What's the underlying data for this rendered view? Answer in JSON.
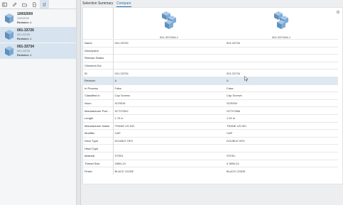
{
  "toolbar": {
    "icons": [
      "panel-icon",
      "edit-icon",
      "folder-icon",
      "document-icon",
      "compare-icon"
    ]
  },
  "left_items": [
    {
      "title": "10002000",
      "subtitle": "10002000",
      "revision_label": "Revision:",
      "revision": "A",
      "selected": false
    },
    {
      "title": "001-33726",
      "subtitle": "001-33726",
      "revision_label": "Revision:",
      "revision": "A",
      "selected": true
    },
    {
      "title": "001-33734",
      "subtitle": "001-33734",
      "revision_label": "Revision:",
      "revision": "A",
      "selected": true
    }
  ],
  "tabs": {
    "summary": "Selection Summary",
    "compare": "Compare"
  },
  "parts": {
    "part1": "001-33726/A.1",
    "part2": "001-33734/A.1"
  },
  "rows": [
    {
      "label": "Name",
      "v1": "001-33726",
      "v2": "001-33734"
    },
    {
      "label": "Description",
      "v1": "",
      "v2": ""
    },
    {
      "label": "Release Status",
      "v1": "",
      "v2": ""
    },
    {
      "label": "Checked-Out",
      "v1": "",
      "v2": ""
    },
    {
      "label": "ID",
      "v1": "001-33726",
      "v2": "001-33734"
    },
    {
      "label": "Revision",
      "v1": "A",
      "v2": "A"
    },
    {
      "label": "In Process",
      "v1": "False",
      "v2": "False"
    },
    {
      "label": "Classified in",
      "v1": "Cap Screws",
      "v2": "Cap Screws"
    },
    {
      "label": "Noun",
      "v1": "SCREW",
      "v2": "SCREW"
    },
    {
      "label": "Manufacturer Part ...",
      "v1": "SCT07842",
      "v2": "SCT07856"
    },
    {
      "label": "Length",
      "v1": "1.75 in",
      "v2": "1.00 in"
    },
    {
      "label": "Manufacturer Name",
      "v1": "TRANE US INC",
      "v2": "TRANE US INC"
    },
    {
      "label": "Modifier",
      "v1": "CAP",
      "v2": "CAP"
    },
    {
      "label": "Drive Type",
      "v1": "DOUBLE HEX",
      "v2": "DOUBLE HEX"
    },
    {
      "label": "Head Type",
      "v1": "",
      "v2": ""
    },
    {
      "label": "Material",
      "v1": "STEEL",
      "v2": "STEEL"
    },
    {
      "label": "Thread Size",
      "v1": "3/8IN-24",
      "v2": "0.38IN-24"
    },
    {
      "label": "Finish",
      "v1": "BLACK OXIDE",
      "v2": "BLACK OXIDE"
    }
  ],
  "colors": {
    "accent": "#2f6fa8",
    "highlight": "#dde8f1",
    "part_icon": "#6f9ec7"
  }
}
